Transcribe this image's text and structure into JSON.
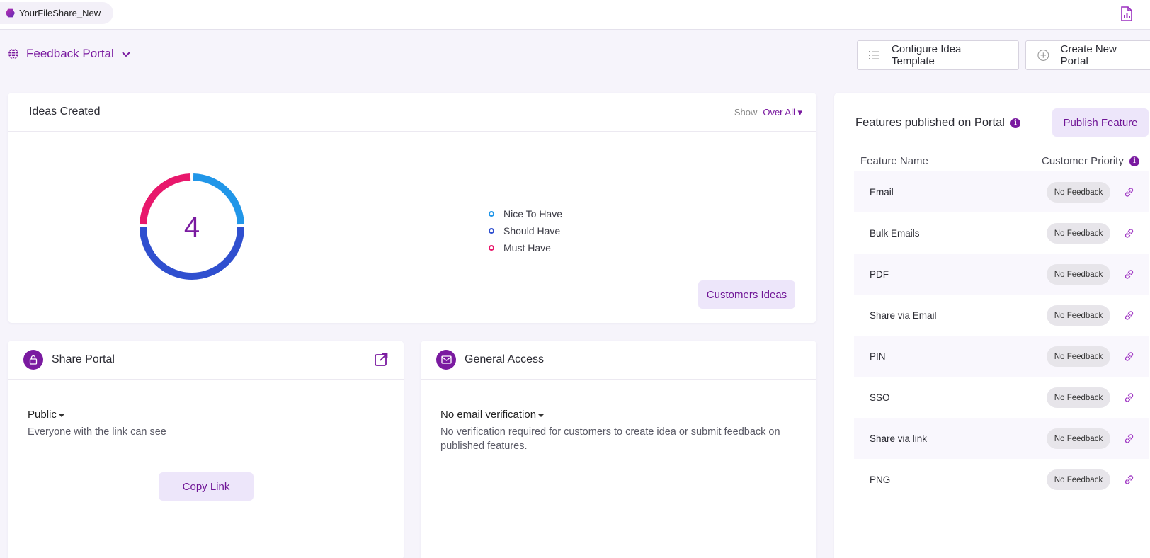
{
  "topbar": {
    "workspace": "YourFileShare_New"
  },
  "portal": {
    "title": "Feedback Portal",
    "configure_label": "Configure Idea Template",
    "create_label": "Create New Portal"
  },
  "ideas": {
    "title": "Ideas Created",
    "show_label": "Show",
    "show_value": "Over All",
    "total": "4",
    "legend": [
      {
        "label": "Nice To Have",
        "color": "#2196e8"
      },
      {
        "label": "Should Have",
        "color": "#2f4fcf"
      },
      {
        "label": "Must Have",
        "color": "#e8186c"
      }
    ],
    "customers_button": "Customers Ideas"
  },
  "share": {
    "title": "Share Portal",
    "access_value": "Public",
    "description": "Everyone with the link can see",
    "copy_button": "Copy Link"
  },
  "general_access": {
    "title": "General Access",
    "verification_value": "No email verification",
    "description": "No verification required for customers to create idea or submit feedback on published features."
  },
  "features": {
    "title": "Features published on Portal",
    "publish_button": "Publish Feature",
    "col_name": "Feature Name",
    "col_priority": "Customer Priority",
    "rows": [
      {
        "name": "Email",
        "priority": "No Feedback"
      },
      {
        "name": "Bulk Emails",
        "priority": "No Feedback"
      },
      {
        "name": "PDF",
        "priority": "No Feedback"
      },
      {
        "name": "Share via Email",
        "priority": "No Feedback"
      },
      {
        "name": "PIN",
        "priority": "No Feedback"
      },
      {
        "name": "SSO",
        "priority": "No Feedback"
      },
      {
        "name": "Share via link",
        "priority": "No Feedback"
      },
      {
        "name": "PNG",
        "priority": "No Feedback"
      }
    ]
  },
  "colors": {
    "accent": "#7a1aa0",
    "soft_button": "#ede6fa"
  }
}
